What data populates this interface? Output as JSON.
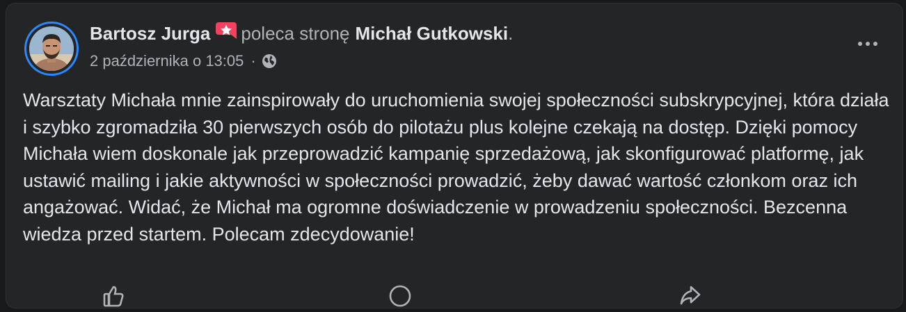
{
  "post": {
    "author": "Bartosz Jurga",
    "recommends_text": "poleca stronę",
    "page_name": "Michał Gutkowski",
    "end_period": ".",
    "timestamp": "2 października o 13:05",
    "separator": "·",
    "privacy_icon": "globe-icon",
    "badge_icon": "star-badge-icon",
    "more_icon": "more-options-icon",
    "body": "Warsztaty Michała mnie zainspirowały do uruchomienia swojej społeczności subskrypcyjnej, która działa i szybko zgromadziła 30 pierwszych osób do pilotażu plus kolejne czekają na dostęp. Dzięki pomocy Michała wiem doskonale jak przeprowadzić kampanię sprzedażową, jak skonfigurować platformę, jak ustawić mailing i jakie aktywności w społeczności prowadzić, żeby dawać wartość członkom oraz ich angażować. Widać, że Michał ma ogromne doświadczenie w prowadzeniu społeczności. Bezcenna wiedza przed startem. Polecam zdecydowanie!"
  },
  "actions": {
    "like_icon": "like-icon",
    "comment_icon": "comment-icon",
    "share_icon": "share-icon"
  },
  "colors": {
    "background": "#18191a",
    "card": "#242526",
    "primary_text": "#e4e6eb",
    "secondary_text": "#b0b3b8",
    "avatar_ring": "#2d88ff",
    "badge": "#f3425f"
  }
}
